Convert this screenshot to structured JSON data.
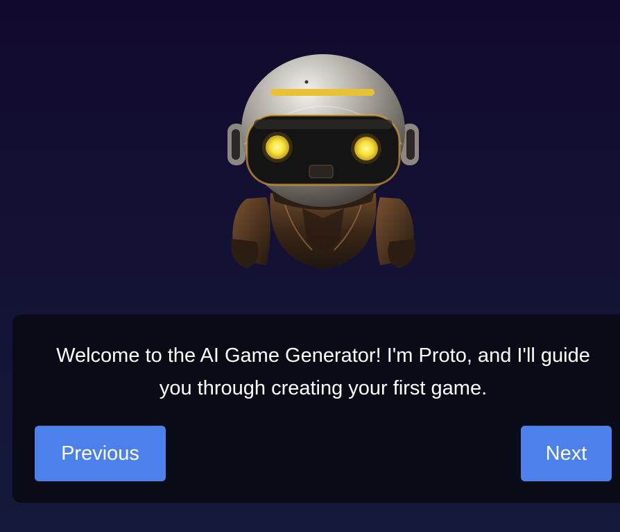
{
  "mascot": {
    "icon": "robot-mascot-icon",
    "visor_color": "#151415",
    "eye_color": "#f4e438",
    "accent_color": "#e0a533"
  },
  "tour": {
    "message": "Welcome to the AI Game Generator! I'm Proto, and I'll guide you through creating your first game.",
    "previous_label": "Previous",
    "next_label": "Next"
  },
  "colors": {
    "background": "#131336",
    "dialog_background": "#090b17",
    "button": "#4c81ec",
    "text": "#ffffff"
  }
}
